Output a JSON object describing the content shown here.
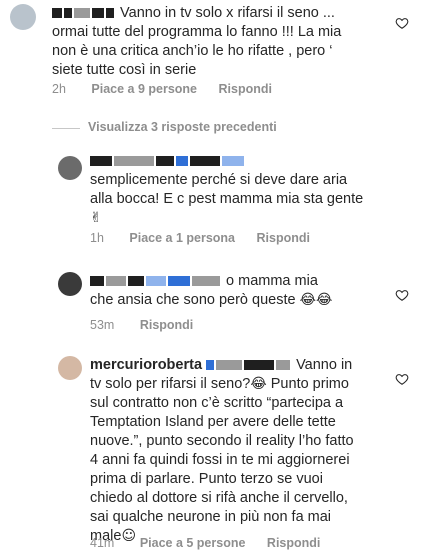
{
  "comments": [
    {
      "text": "Vanno in tv solo x rifarsi il seno ... ormai tutte del programma lo fanno !!! La mia non è una critica anch’io le ho rifatte , pero ‘ siete tutte così in serie",
      "line1": "Vanno in tv solo x rifarsi il seno ...",
      "line2": "ormai tutte del programma lo fanno !!! La mia",
      "line3": "non è una critica anch’io le ho rifatte , pero ‘",
      "line4": "siete tutte così in serie",
      "time": "2h",
      "likes": "Piace a 9 persone",
      "reply": "Rispondi"
    },
    {
      "line1": "semplicemente perché si deve dare aria",
      "line2": "alla bocca! E c pest mamma mia sta gente",
      "emoji": "✌",
      "time": "1h",
      "likes": "Piace a 1 persona",
      "reply": "Rispondi"
    },
    {
      "line1_tail": "o mamma mia",
      "line2": "che ansia che sono però queste",
      "emoji": "😂😂",
      "time": "53m",
      "reply": "Rispondi"
    },
    {
      "username": "mercurioroberta",
      "line1_tail": "Vanno in",
      "line2": "tv solo per rifarsi il seno?",
      "line2_emoji": "😂",
      "line2_tail": " Punto primo",
      "line3": "sul contratto non c’è scritto “partecipa a",
      "line4": "Temptation Island per avere delle tette",
      "line5": "nuove.”, punto secondo il reality l’ho fatto",
      "line6": "4 anni fa quindi fossi in te mi aggiornerei",
      "line7": "prima di parlare. Punto terzo se vuoi",
      "line8": "chiedo al dottore si rifà anche il cervello,",
      "line9": "sai qualche neurone in più non fa mai",
      "line10": "male",
      "line10_emoji": "☺",
      "time": "41m",
      "likes": "Piace a 5 persone",
      "reply": "Rispondi"
    }
  ],
  "view_replies": "Visualizza 3 risposte precedenti"
}
